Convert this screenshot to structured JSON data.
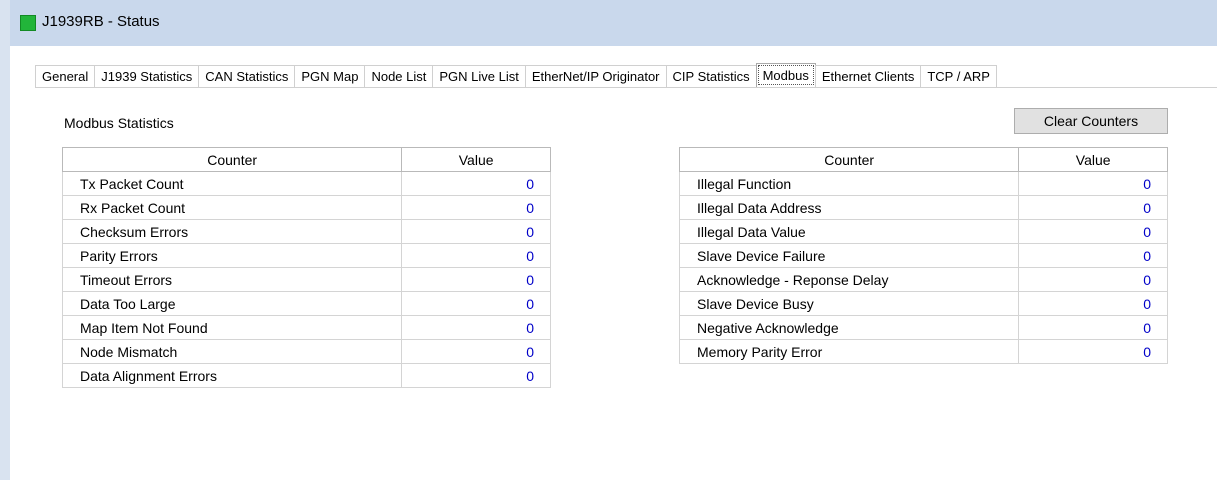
{
  "window": {
    "title": "J1939RB - Status"
  },
  "tabs": [
    {
      "label": "General"
    },
    {
      "label": "J1939 Statistics"
    },
    {
      "label": "CAN Statistics"
    },
    {
      "label": "PGN Map"
    },
    {
      "label": "Node List"
    },
    {
      "label": "PGN Live List"
    },
    {
      "label": "EtherNet/IP Originator"
    },
    {
      "label": "CIP Statistics"
    },
    {
      "label": "Modbus",
      "active": true
    },
    {
      "label": "Ethernet Clients"
    },
    {
      "label": "TCP / ARP"
    }
  ],
  "section": {
    "title": "Modbus Statistics"
  },
  "clear_button": {
    "label": "Clear Counters"
  },
  "left_table": {
    "headers": {
      "counter": "Counter",
      "value": "Value"
    },
    "rows": [
      {
        "name": "Tx Packet Count",
        "value": "0"
      },
      {
        "name": "Rx Packet Count",
        "value": "0"
      },
      {
        "name": "Checksum Errors",
        "value": "0"
      },
      {
        "name": "Parity Errors",
        "value": "0"
      },
      {
        "name": "Timeout Errors",
        "value": "0"
      },
      {
        "name": "Data Too Large",
        "value": "0"
      },
      {
        "name": "Map Item Not Found",
        "value": "0"
      },
      {
        "name": "Node Mismatch",
        "value": "0"
      },
      {
        "name": "Data Alignment Errors",
        "value": "0"
      }
    ]
  },
  "right_table": {
    "headers": {
      "counter": "Counter",
      "value": "Value"
    },
    "rows": [
      {
        "name": "Illegal Function",
        "value": "0"
      },
      {
        "name": "Illegal Data Address",
        "value": "0"
      },
      {
        "name": "Illegal Data Value",
        "value": "0"
      },
      {
        "name": "Slave Device Failure",
        "value": "0"
      },
      {
        "name": "Acknowledge - Reponse Delay",
        "value": "0"
      },
      {
        "name": "Slave Device Busy",
        "value": "0"
      },
      {
        "name": "Negative Acknowledge",
        "value": "0"
      },
      {
        "name": "Memory Parity Error",
        "value": "0"
      }
    ]
  },
  "colors": {
    "value_text": "#0000c8",
    "status_icon": "#22b53a",
    "titlebar": "#c9d8ec"
  }
}
